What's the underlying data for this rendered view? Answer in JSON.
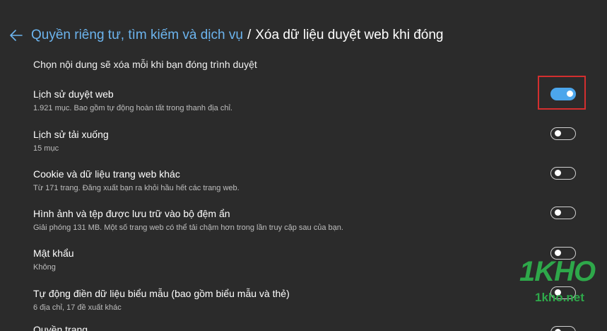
{
  "header": {
    "back_icon": "arrow-left-icon",
    "parent_label": "Quyền riêng tư, tìm kiếm và dịch vụ",
    "separator": "/",
    "current_label": "Xóa dữ liệu duyệt web khi đóng"
  },
  "description": "Chọn nội dung sẽ xóa mỗi khi bạn đóng trình duyệt",
  "items": [
    {
      "title": "Lịch sử duyệt web",
      "subtitle": "1.921 mục. Bao gồm tự động hoàn tất trong thanh địa chỉ.",
      "enabled": true
    },
    {
      "title": "Lịch sử tải xuống",
      "subtitle": "15 mục",
      "enabled": false
    },
    {
      "title": "Cookie và dữ liệu trang web khác",
      "subtitle": "Từ 171 trang. Đăng xuất bạn ra khỏi hầu hết các trang web.",
      "enabled": false
    },
    {
      "title": "Hình ảnh và tệp được lưu trữ vào bộ đệm ẩn",
      "subtitle": "Giải phóng 131 MB. Một số trang web có thể tải chậm hơn trong lần truy cập sau của bạn.",
      "enabled": false
    },
    {
      "title": "Mật khẩu",
      "subtitle": "Không",
      "enabled": false
    },
    {
      "title": "Tự động điền dữ liệu biểu mẫu (bao gồm biểu mẫu và thẻ)",
      "subtitle": "6 địa chỉ, 17 đề xuất khác",
      "enabled": false
    },
    {
      "title": "Quyền trang",
      "subtitle": "",
      "enabled": false
    }
  ],
  "watermark": {
    "logo_text": "1KHO",
    "site_text": "1kho.net"
  },
  "colors": {
    "background": "#2b2b2b",
    "link": "#6cb4ee",
    "toggle_on": "#4ca6ec",
    "highlight": "#d32f2f",
    "watermark": "#2ea84a"
  }
}
